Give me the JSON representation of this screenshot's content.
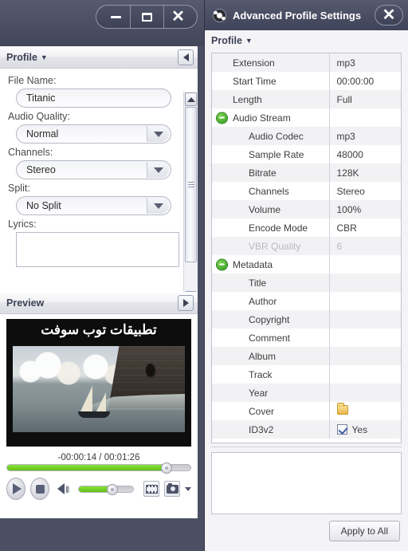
{
  "left_window": {
    "controls": {
      "minimize": "minimize-button",
      "maximize": "maximize-button",
      "close": "close-button"
    },
    "profile_section": {
      "title": "Profile",
      "caret": "▼",
      "collapse_icon": "collapse-left-arrow"
    },
    "fields": [
      {
        "label": "File Name:",
        "value": "Titanic",
        "type": "text"
      },
      {
        "label": "Audio Quality:",
        "value": "Normal",
        "type": "combo"
      },
      {
        "label": "Channels:",
        "value": "Stereo",
        "type": "combo"
      },
      {
        "label": "Split:",
        "value": "No Split",
        "type": "combo"
      },
      {
        "label": "Lyrics:",
        "value": "",
        "type": "textarea"
      }
    ],
    "preview_section": {
      "title": "Preview",
      "expand_icon": "expand-right-arrow"
    },
    "video": {
      "overlay_title": "تطبيقات توب سوفت"
    },
    "player": {
      "time": "-00:00:14 / 00:01:26",
      "seek_percent": 87,
      "volume_percent": 62,
      "play_label": "play-button",
      "stop_label": "stop-button",
      "snapshot_folder": "film-icon",
      "snapshot_camera": "camera-icon"
    }
  },
  "right_window": {
    "title": "Advanced Profile Settings",
    "close": "close-button",
    "profile_label": "Profile",
    "profile_caret": "▼",
    "rows": [
      {
        "key": "Extension",
        "value": "mp3",
        "level": 1,
        "group": false,
        "dim": false
      },
      {
        "key": "Start Time",
        "value": "00:00:00",
        "level": 1,
        "group": false,
        "dim": false
      },
      {
        "key": "Length",
        "value": "Full",
        "level": 1,
        "group": false,
        "dim": false
      },
      {
        "key": "Audio Stream",
        "value": "",
        "level": 1,
        "group": true,
        "dim": false
      },
      {
        "key": "Audio Codec",
        "value": "mp3",
        "level": 2,
        "group": false,
        "dim": false
      },
      {
        "key": "Sample Rate",
        "value": "48000",
        "level": 2,
        "group": false,
        "dim": false
      },
      {
        "key": "Bitrate",
        "value": "128K",
        "level": 2,
        "group": false,
        "dim": false
      },
      {
        "key": "Channels",
        "value": "Stereo",
        "level": 2,
        "group": false,
        "dim": false
      },
      {
        "key": "Volume",
        "value": "100%",
        "level": 2,
        "group": false,
        "dim": false
      },
      {
        "key": "Encode Mode",
        "value": "CBR",
        "level": 2,
        "group": false,
        "dim": false
      },
      {
        "key": "VBR Quality",
        "value": "6",
        "level": 2,
        "group": false,
        "dim": true
      },
      {
        "key": "Metadata",
        "value": "",
        "level": 1,
        "group": true,
        "dim": false
      },
      {
        "key": "Title",
        "value": "",
        "level": 2,
        "group": false,
        "dim": false
      },
      {
        "key": "Author",
        "value": "",
        "level": 2,
        "group": false,
        "dim": false
      },
      {
        "key": "Copyright",
        "value": "",
        "level": 2,
        "group": false,
        "dim": false
      },
      {
        "key": "Comment",
        "value": "",
        "level": 2,
        "group": false,
        "dim": false
      },
      {
        "key": "Album",
        "value": "",
        "level": 2,
        "group": false,
        "dim": false
      },
      {
        "key": "Track",
        "value": "",
        "level": 2,
        "group": false,
        "dim": false
      },
      {
        "key": "Year",
        "value": "",
        "level": 2,
        "group": false,
        "dim": false
      },
      {
        "key": "Cover",
        "value": "",
        "level": 2,
        "group": false,
        "dim": false,
        "icon": "folder"
      },
      {
        "key": "ID3v2",
        "value": "Yes",
        "level": 2,
        "group": false,
        "dim": false,
        "checkbox": true
      }
    ],
    "apply_button": "Apply to All"
  },
  "colors": {
    "titlebar": "#4a4e63",
    "accent_green": "#7ad034",
    "panel_bg": "#f4f4f7",
    "text_dark": "#3d4154"
  }
}
